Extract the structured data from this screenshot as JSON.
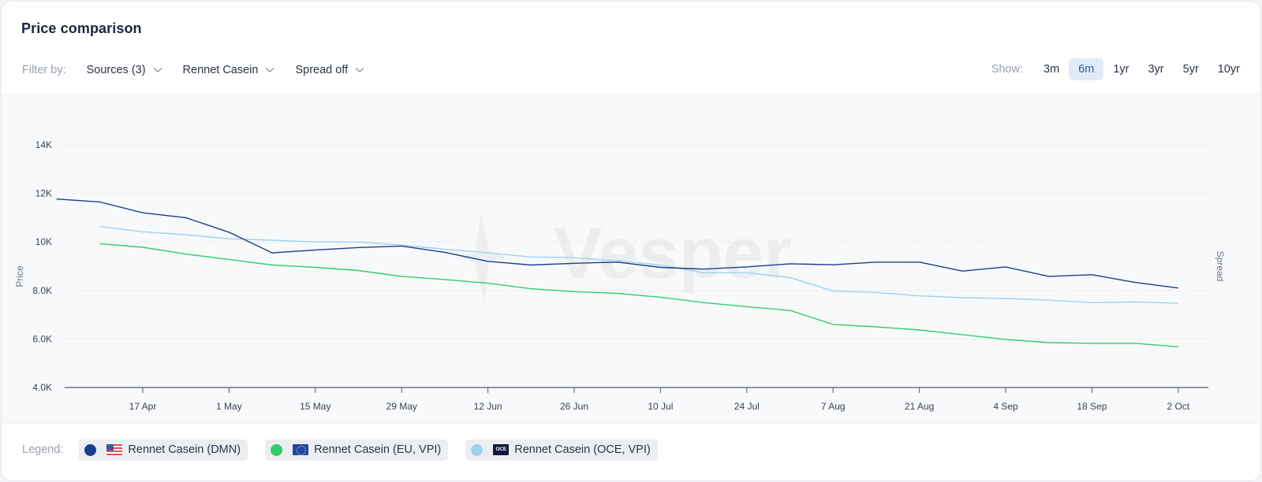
{
  "header": {
    "title": "Price comparison"
  },
  "filters": {
    "label": "Filter by:",
    "items": [
      {
        "label": "Sources (3)",
        "icon": "chevron-down-icon"
      },
      {
        "label": "Rennet Casein",
        "icon": "chevron-down-icon"
      },
      {
        "label": "Spread off",
        "icon": "chevron-down-icon"
      }
    ]
  },
  "range": {
    "label": "Show:",
    "options": [
      "3m",
      "6m",
      "1yr",
      "3yr",
      "5yr",
      "10yr"
    ],
    "selected": "6m"
  },
  "watermark": "Vesper",
  "legend": {
    "label": "Legend:",
    "items": [
      {
        "label": "Rennet Casein (DMN)",
        "color": "#1a3f8f",
        "flag": "us-flag-icon"
      },
      {
        "label": "Rennet Casein (EU, VPI)",
        "color": "#2fcf6a",
        "flag": "eu-flag-icon"
      },
      {
        "label": "Rennet Casein (OCE, VPI)",
        "color": "#9dd2f0",
        "flag": "oce-flag-icon",
        "flag_text": "OCE"
      }
    ]
  },
  "colors": {
    "accent": "#2a5fa8",
    "active_bg": "#e1ebf8"
  },
  "chart_data": {
    "type": "line",
    "title": "Price comparison",
    "xlabel": "",
    "ylabel": "Price",
    "y2label": "Spread",
    "ylim": [
      4000,
      14000
    ],
    "yticks": [
      4000,
      6000,
      8000,
      10000,
      12000,
      14000
    ],
    "ytick_labels": [
      "4.0K",
      "6.0K",
      "8.0K",
      "10K",
      "12K",
      "14K"
    ],
    "xtick_labels": [
      "17 Apr",
      "1 May",
      "15 May",
      "29 May",
      "12 Jun",
      "26 Jun",
      "10 Jul",
      "24 Jul",
      "7 Aug",
      "21 Aug",
      "4 Sep",
      "18 Sep",
      "2 Oct"
    ],
    "x_start_offset_weeks": -2,
    "x_interval": "weekly",
    "grid": true,
    "legend_position": "bottom",
    "series": [
      {
        "name": "Rennet Casein (DMN)",
        "color": "#1a3f8f",
        "start_week": 0,
        "values": [
          11770,
          11650,
          11200,
          11000,
          10400,
          9550,
          9670,
          9770,
          9830,
          9570,
          9200,
          9050,
          9120,
          9170,
          8950,
          8880,
          8970,
          9100,
          9060,
          9170,
          9170,
          8800,
          8970,
          8580,
          8650,
          8330,
          8100
        ]
      },
      {
        "name": "Rennet Casein (EU, VPI)",
        "color": "#2fcf6a",
        "start_week": 1,
        "values": [
          9930,
          9780,
          9500,
          9280,
          9050,
          8950,
          8820,
          8580,
          8450,
          8300,
          8070,
          7950,
          7880,
          7720,
          7500,
          7330,
          7180,
          6600,
          6500,
          6370,
          6180,
          5980,
          5850,
          5820,
          5820,
          5680
        ]
      },
      {
        "name": "Rennet Casein (OCE, VPI)",
        "color": "#9dd2f0",
        "start_week": 1,
        "values": [
          10640,
          10420,
          10300,
          10130,
          10070,
          10000,
          10000,
          9870,
          9700,
          9550,
          9380,
          9350,
          9220,
          9050,
          8730,
          8730,
          8530,
          7980,
          7920,
          7780,
          7700,
          7670,
          7600,
          7500,
          7530,
          7470
        ]
      }
    ]
  }
}
